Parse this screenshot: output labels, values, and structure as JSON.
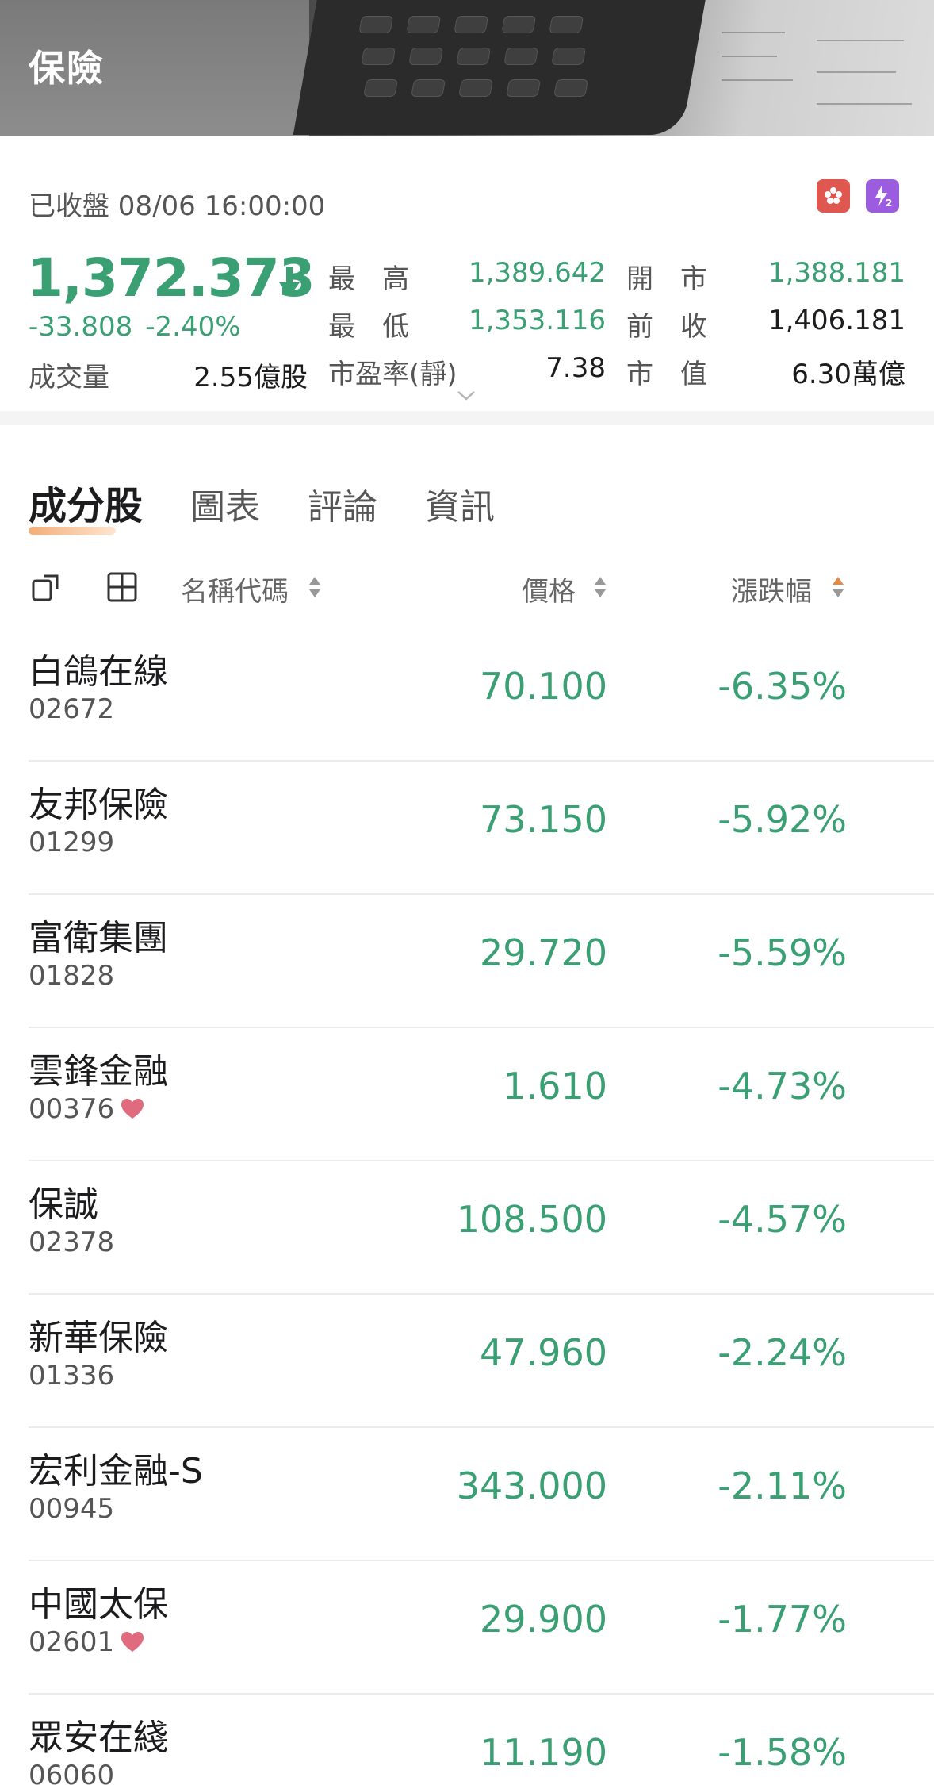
{
  "header": {
    "title": "保險"
  },
  "quote": {
    "status": "已收盤 08/06 16:00:00",
    "last": "1,372.373",
    "change": "-33.808",
    "change_pct": "-2.40%",
    "volume_label": "成交量",
    "volume_value": "2.55億股",
    "stats": [
      {
        "label": "最　高",
        "value": "1,389.642",
        "tone": "green"
      },
      {
        "label": "開　市",
        "value": "1,388.181",
        "tone": "green"
      },
      {
        "label": "最　低",
        "value": "1,353.116",
        "tone": "green"
      },
      {
        "label": "前　收",
        "value": "1,406.181",
        "tone": "dark"
      },
      {
        "label": "市盈率(靜)",
        "value": "7.38",
        "tone": "dark"
      },
      {
        "label": "市　值",
        "value": "6.30萬億",
        "tone": "dark"
      }
    ]
  },
  "market_icons": {
    "hk": "hk-flag-icon",
    "level2": "level2-icon"
  },
  "tabs": [
    {
      "label": "成分股",
      "active": true
    },
    {
      "label": "圖表",
      "active": false
    },
    {
      "label": "評論",
      "active": false
    },
    {
      "label": "資訊",
      "active": false
    }
  ],
  "columns": {
    "name": "名稱代碼",
    "price": "價格",
    "change": "漲跌幅"
  },
  "stocks": [
    {
      "name": "白鴿在線",
      "code": "02672",
      "price": "70.100",
      "change": "-6.35%",
      "fav": false
    },
    {
      "name": "友邦保險",
      "code": "01299",
      "price": "73.150",
      "change": "-5.92%",
      "fav": false
    },
    {
      "name": "富衛集團",
      "code": "01828",
      "price": "29.720",
      "change": "-5.59%",
      "fav": false
    },
    {
      "name": "雲鋒金融",
      "code": "00376",
      "price": "1.610",
      "change": "-4.73%",
      "fav": true
    },
    {
      "name": "保誠",
      "code": "02378",
      "price": "108.500",
      "change": "-4.57%",
      "fav": false
    },
    {
      "name": "新華保險",
      "code": "01336",
      "price": "47.960",
      "change": "-2.24%",
      "fav": false
    },
    {
      "name": "宏利金融-S",
      "code": "00945",
      "price": "343.000",
      "change": "-2.11%",
      "fav": false
    },
    {
      "name": "中國太保",
      "code": "02601",
      "price": "29.900",
      "change": "-1.77%",
      "fav": true
    },
    {
      "name": "眾安在綫",
      "code": "06060",
      "price": "11.190",
      "change": "-1.58%",
      "fav": false
    }
  ],
  "colors": {
    "down": "#3aa074",
    "accent": "#f0a060",
    "heart": "#e06a7e"
  }
}
